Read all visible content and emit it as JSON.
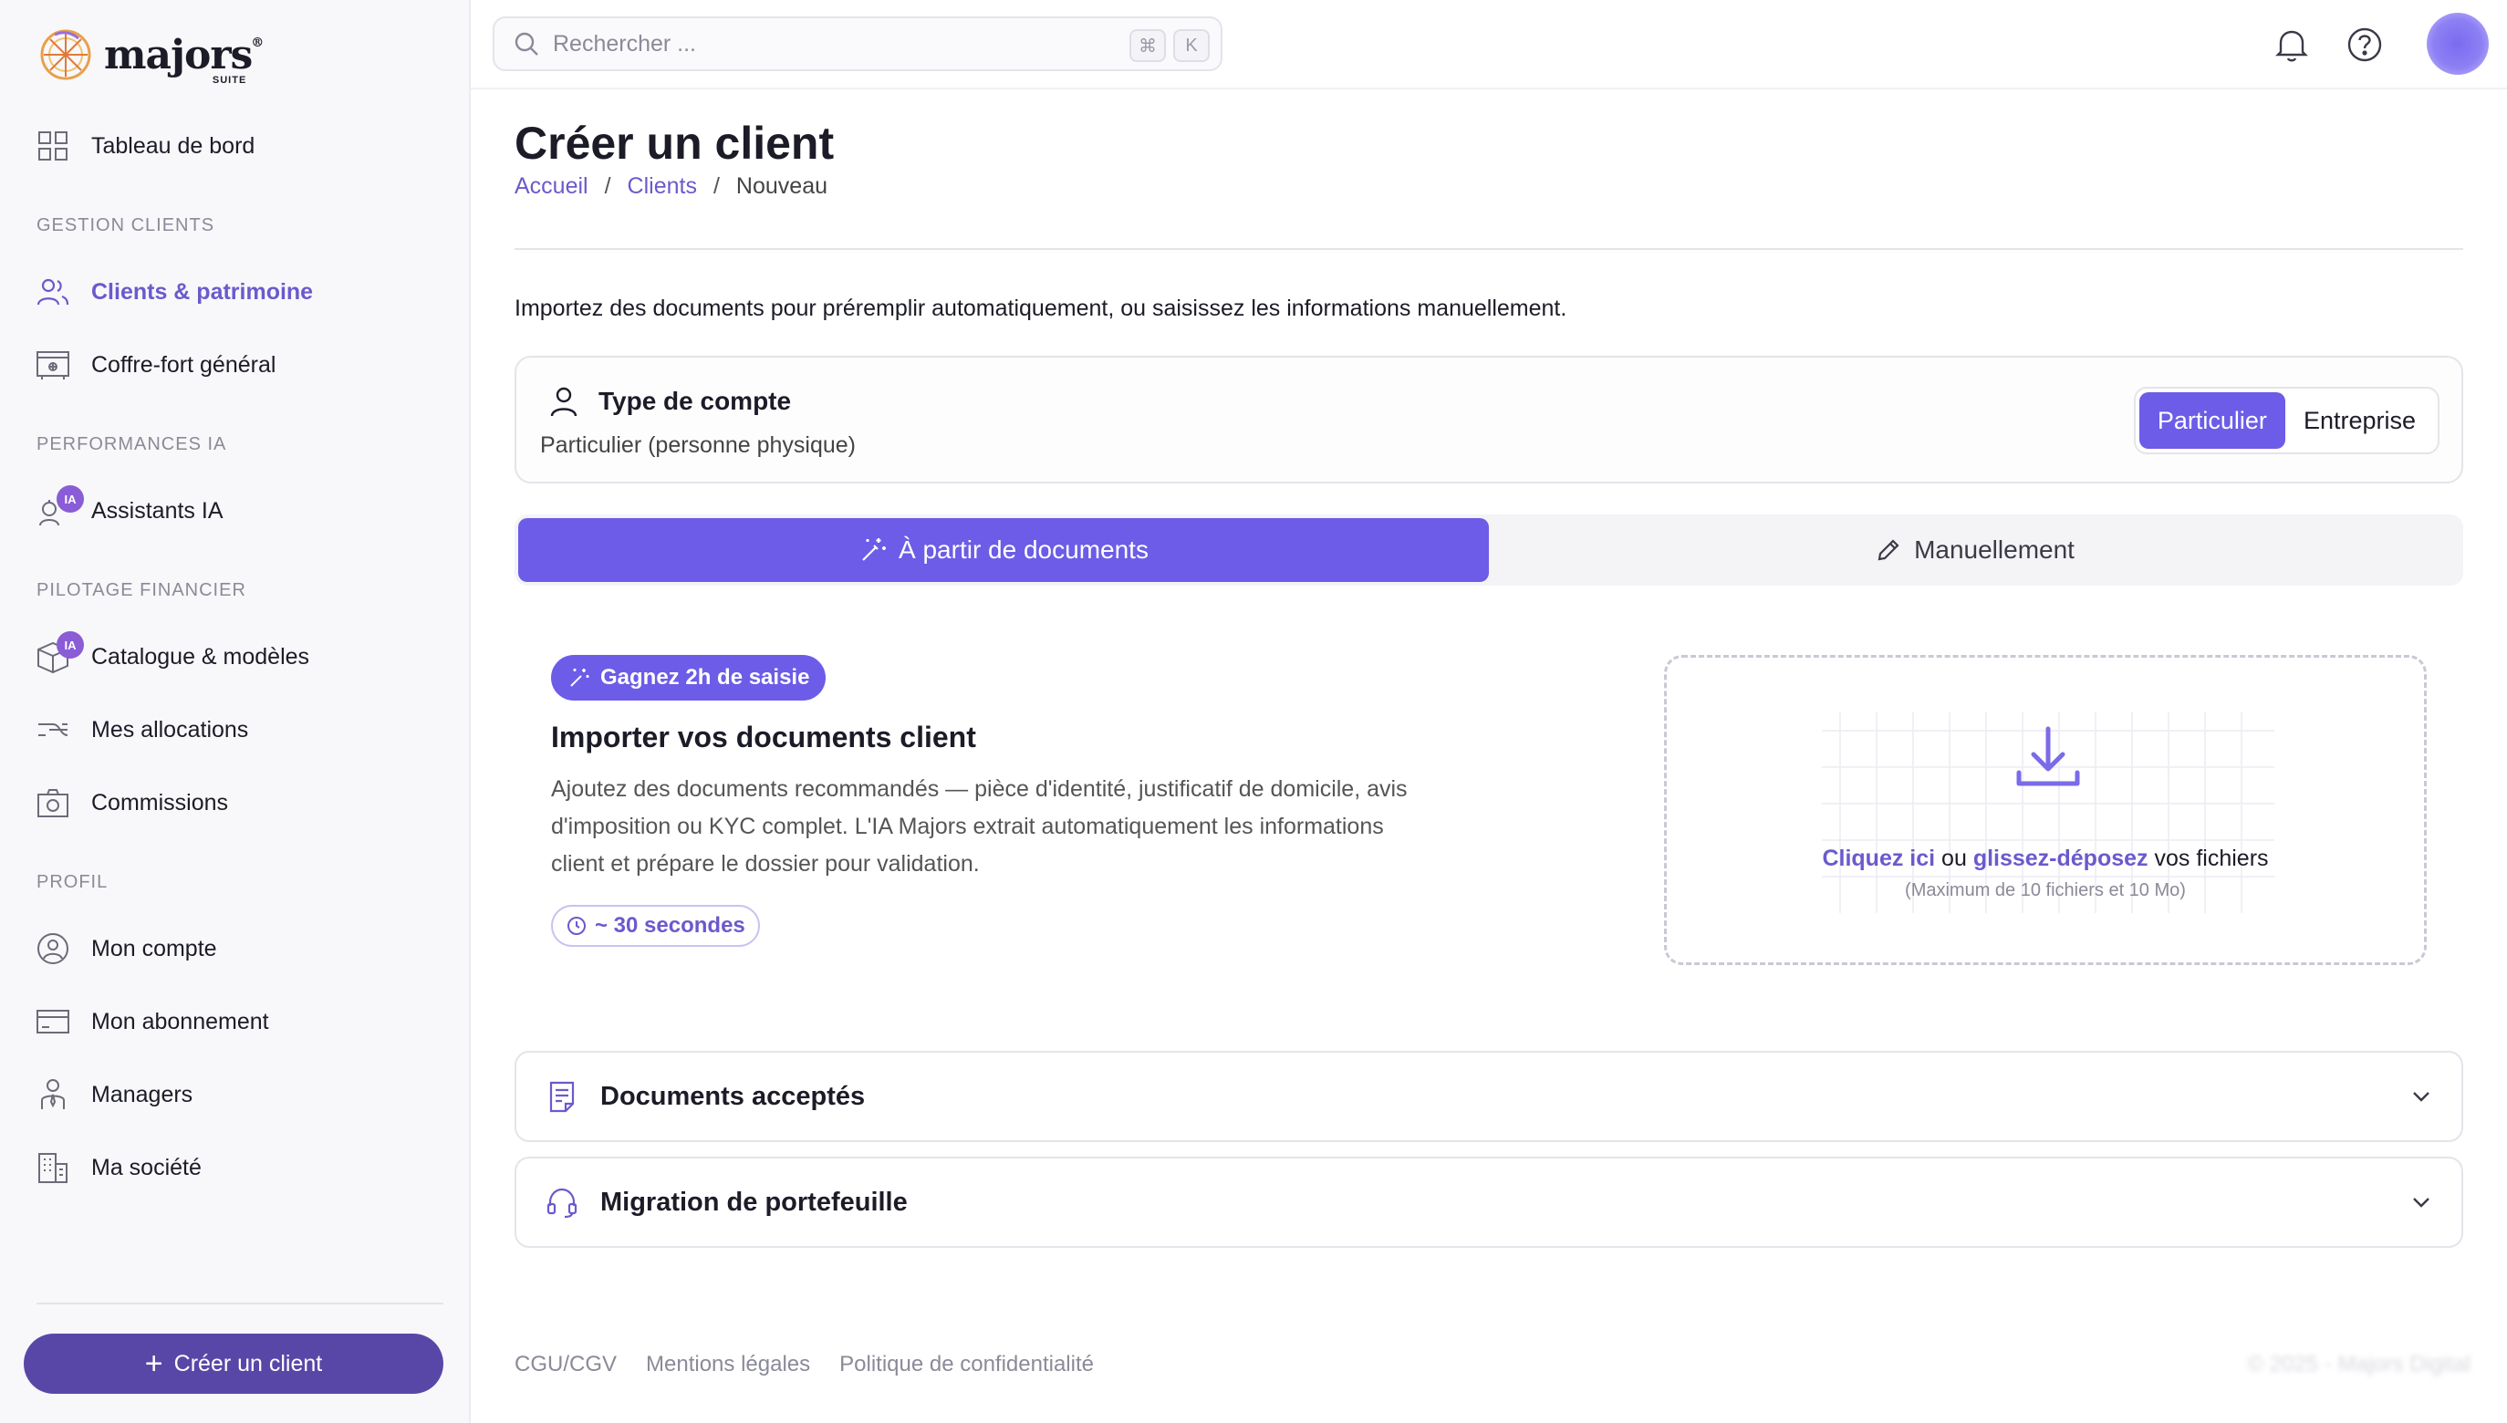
{
  "brand": {
    "name": "majors",
    "suite": "SUITE",
    "reg": "®"
  },
  "sidebar": {
    "dashboard": "Tableau de bord",
    "sections": {
      "clients": "GESTION CLIENTS",
      "ia": "PERFORMANCES IA",
      "finance": "PILOTAGE FINANCIER",
      "profile": "PROFIL"
    },
    "items": {
      "clients_patrimoine": "Clients & patrimoine",
      "coffre_fort": "Coffre-fort général",
      "assistants_ia": "Assistants IA",
      "catalogue": "Catalogue & modèles",
      "allocations": "Mes allocations",
      "commissions": "Commissions",
      "mon_compte": "Mon compte",
      "abonnement": "Mon abonnement",
      "managers": "Managers",
      "societe": "Ma société"
    },
    "ia_badge": "IA",
    "create_button": "Créer un client"
  },
  "search": {
    "placeholder": "Rechercher ...",
    "kbd1": "⌘",
    "kbd2": "K"
  },
  "page": {
    "title": "Créer un client",
    "breadcrumb": {
      "home": "Accueil",
      "clients": "Clients",
      "current": "Nouveau"
    },
    "intro": "Importez des documents pour préremplir automatiquement, ou saisissez les informations manuellement."
  },
  "account": {
    "title": "Type de compte",
    "subtitle": "Particulier (personne physique)",
    "options": {
      "particulier": "Particulier",
      "entreprise": "Entreprise"
    }
  },
  "mode": {
    "documents": "À partir de documents",
    "manual": "Manuellement"
  },
  "import": {
    "pill": "Gagnez 2h de saisie",
    "title": "Importer vos documents client",
    "description": "Ajoutez des documents recommandés — pièce d'identité, justificatif de domicile, avis d'imposition ou KYC complet. L'IA Majors extrait automatiquement les informations client et prépare le dossier pour validation.",
    "time": "~ 30 secondes"
  },
  "dropzone": {
    "click": "Cliquez ici",
    "or": " ou ",
    "drag": "glissez-déposez",
    "files": " vos fichiers",
    "hint": "(Maximum de 10 fichiers et 10 Mo)"
  },
  "accordions": {
    "docs": "Documents acceptés",
    "migration": "Migration de portefeuille"
  },
  "footer": {
    "cgu": "CGU/CGV",
    "mentions": "Mentions légales",
    "privacy": "Politique de confidentialité",
    "copyright": "© 2025 - Majors Digital"
  },
  "colors": {
    "accent": "#6c5ce7",
    "accent_dark": "#5947a8",
    "accent_text": "#6a5acd",
    "ia_badge": "#8a5cd6"
  }
}
